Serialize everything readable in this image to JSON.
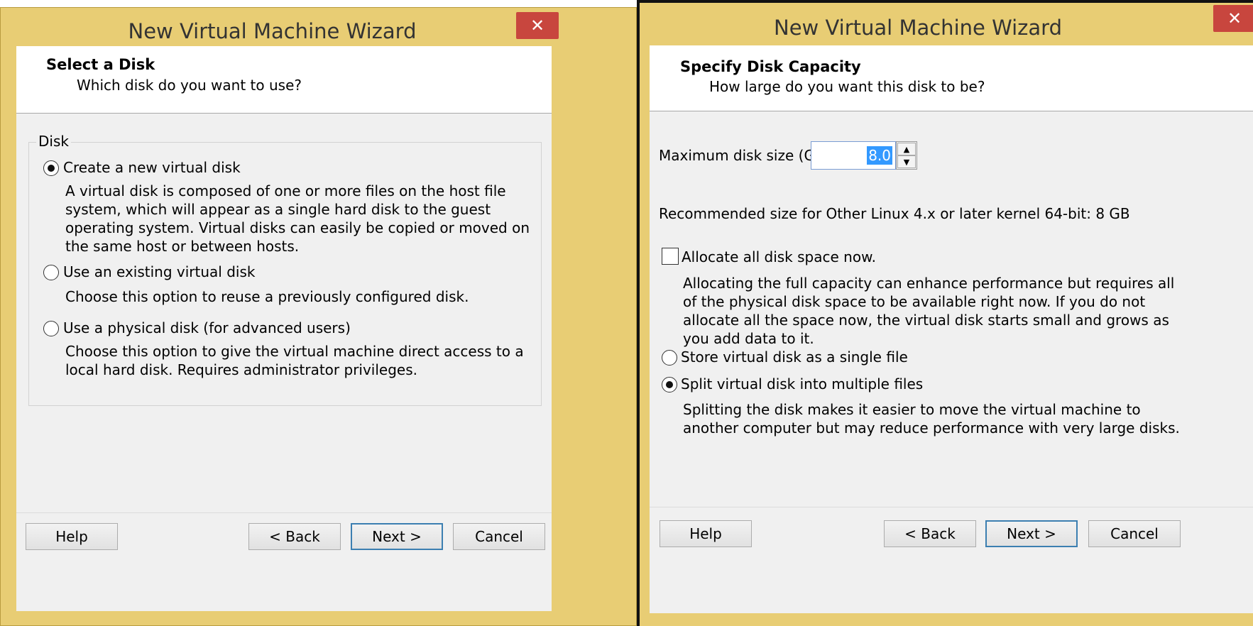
{
  "left_window": {
    "title": "New Virtual Machine Wizard",
    "close_glyph": "✕",
    "header": {
      "title": "Select a Disk",
      "subtitle": "Which disk do you want to use?"
    },
    "group_label": "Disk",
    "options": [
      {
        "label": "Create a new virtual disk",
        "selected": true,
        "description": "A virtual disk is composed of one or more files on the host file system, which will appear as a single hard disk to the guest operating system. Virtual disks can easily be copied or moved on the same host or between hosts."
      },
      {
        "label": "Use an existing virtual disk",
        "selected": false,
        "description": "Choose this option to reuse a previously configured disk."
      },
      {
        "label": "Use a physical disk (for advanced users)",
        "selected": false,
        "description": "Choose this option to give the virtual machine direct access to a local hard disk. Requires administrator privileges."
      }
    ],
    "buttons": {
      "help": "Help",
      "back": "< Back",
      "next": "Next >",
      "cancel": "Cancel"
    }
  },
  "right_window": {
    "title": "New Virtual Machine Wizard",
    "close_glyph": "✕",
    "header": {
      "title": "Specify Disk Capacity",
      "subtitle": "How large do you want this disk to be?"
    },
    "disk_size_label": "Maximum disk size (GB):",
    "disk_size_value": "8.0",
    "recommended_text": "Recommended size for Other Linux 4.x or later kernel 64-bit: 8 GB",
    "allocate_label": "Allocate all disk space now.",
    "allocate_checked": false,
    "allocate_description": "Allocating the full capacity can enhance performance but requires all of the physical disk space to be available right now. If you do not allocate all the space now, the virtual disk starts small and grows as you add data to it.",
    "options": [
      {
        "label": "Store virtual disk as a single file",
        "selected": false
      },
      {
        "label": "Split virtual disk into multiple files",
        "selected": true
      }
    ],
    "split_description": "Splitting the disk makes it easier to move the virtual machine to another computer but may reduce performance with very large disks.",
    "buttons": {
      "help": "Help",
      "back": "< Back",
      "next": "Next >",
      "cancel": "Cancel"
    }
  },
  "colors": {
    "title_bar": "#e8cd74",
    "close_button": "#c8463e",
    "selection": "#3399ff",
    "default_button_border": "#3c7fb1"
  }
}
